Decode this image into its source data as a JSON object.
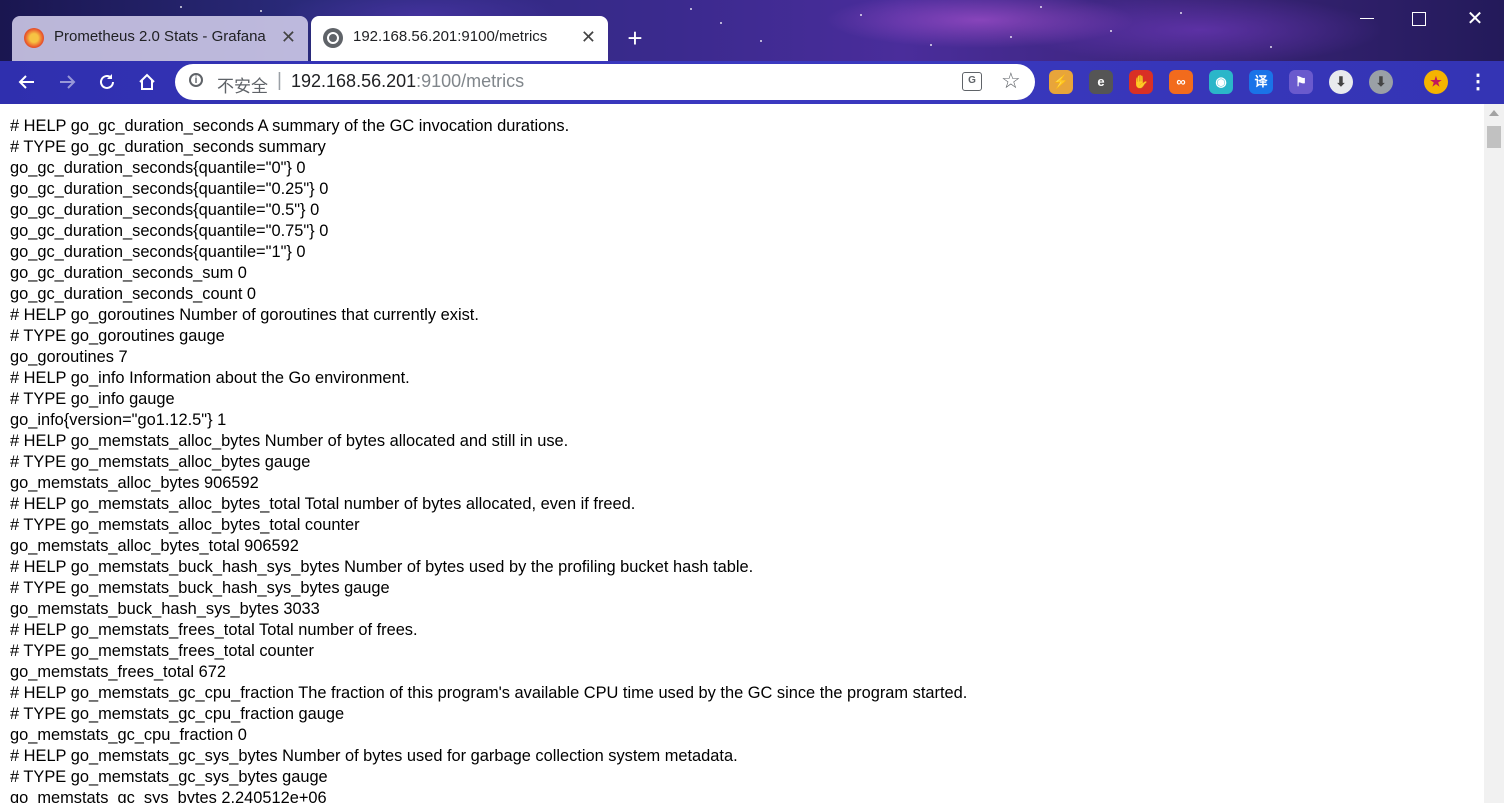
{
  "browser": {
    "tabs": [
      {
        "title": "Prometheus 2.0 Stats - Grafana",
        "favicon": "grafana-icon",
        "active": false
      },
      {
        "title": "192.168.56.201:9100/metrics",
        "favicon": "globe-icon",
        "active": true
      }
    ],
    "new_tab_icon": "plus-icon",
    "window_controls": {
      "minimize": "minimize-icon",
      "maximize": "maximize-icon",
      "close": "close-icon"
    },
    "toolbar": {
      "back_icon": "back-arrow-icon",
      "forward_icon": "forward-arrow-icon",
      "reload_icon": "reload-icon",
      "home_icon": "home-icon"
    },
    "omnibox": {
      "security_label": "不安全",
      "separator": "|",
      "url_host": "192.168.56.201",
      "url_rest": ":9100/metrics",
      "translate_glyph": "G",
      "bookmark_icon": "star-icon"
    },
    "extensions": [
      {
        "name": "ext-colorful-icon",
        "glyph": "⚡",
        "color": "#e8a53a"
      },
      {
        "name": "ext-e-icon",
        "glyph": "e",
        "color": "#555555"
      },
      {
        "name": "ext-stop-hand-icon",
        "glyph": "✋",
        "color": "#d93025"
      },
      {
        "name": "ext-infinity-icon",
        "glyph": "∞",
        "color": "#f26b1d"
      },
      {
        "name": "ext-circle-icon",
        "glyph": "◉",
        "color": "#2bb6c9"
      },
      {
        "name": "ext-translate-icon",
        "glyph": "译",
        "color": "#1a73e8"
      },
      {
        "name": "ext-puzzle-icon",
        "glyph": "⚑",
        "color": "#6a5acd"
      },
      {
        "name": "ext-download-icon",
        "glyph": "⬇",
        "color": "#e8eaed"
      },
      {
        "name": "ext-download2-icon",
        "glyph": "⬇",
        "color": "#9aa0a6"
      },
      {
        "name": "profile-avatar-icon",
        "glyph": "★",
        "color": "#f5b400"
      }
    ],
    "menu_icon": "⋮"
  },
  "page": {
    "lines": [
      "# HELP go_gc_duration_seconds A summary of the GC invocation durations.",
      "# TYPE go_gc_duration_seconds summary",
      "go_gc_duration_seconds{quantile=\"0\"} 0",
      "go_gc_duration_seconds{quantile=\"0.25\"} 0",
      "go_gc_duration_seconds{quantile=\"0.5\"} 0",
      "go_gc_duration_seconds{quantile=\"0.75\"} 0",
      "go_gc_duration_seconds{quantile=\"1\"} 0",
      "go_gc_duration_seconds_sum 0",
      "go_gc_duration_seconds_count 0",
      "# HELP go_goroutines Number of goroutines that currently exist.",
      "# TYPE go_goroutines gauge",
      "go_goroutines 7",
      "# HELP go_info Information about the Go environment.",
      "# TYPE go_info gauge",
      "go_info{version=\"go1.12.5\"} 1",
      "# HELP go_memstats_alloc_bytes Number of bytes allocated and still in use.",
      "# TYPE go_memstats_alloc_bytes gauge",
      "go_memstats_alloc_bytes 906592",
      "# HELP go_memstats_alloc_bytes_total Total number of bytes allocated, even if freed.",
      "# TYPE go_memstats_alloc_bytes_total counter",
      "go_memstats_alloc_bytes_total 906592",
      "# HELP go_memstats_buck_hash_sys_bytes Number of bytes used by the profiling bucket hash table.",
      "# TYPE go_memstats_buck_hash_sys_bytes gauge",
      "go_memstats_buck_hash_sys_bytes 3033",
      "# HELP go_memstats_frees_total Total number of frees.",
      "# TYPE go_memstats_frees_total counter",
      "go_memstats_frees_total 672",
      "# HELP go_memstats_gc_cpu_fraction The fraction of this program's available CPU time used by the GC since the program started.",
      "# TYPE go_memstats_gc_cpu_fraction gauge",
      "go_memstats_gc_cpu_fraction 0",
      "# HELP go_memstats_gc_sys_bytes Number of bytes used for garbage collection system metadata.",
      "# TYPE go_memstats_gc_sys_bytes gauge",
      "go_memstats_gc_sys_bytes 2.240512e+06"
    ]
  }
}
